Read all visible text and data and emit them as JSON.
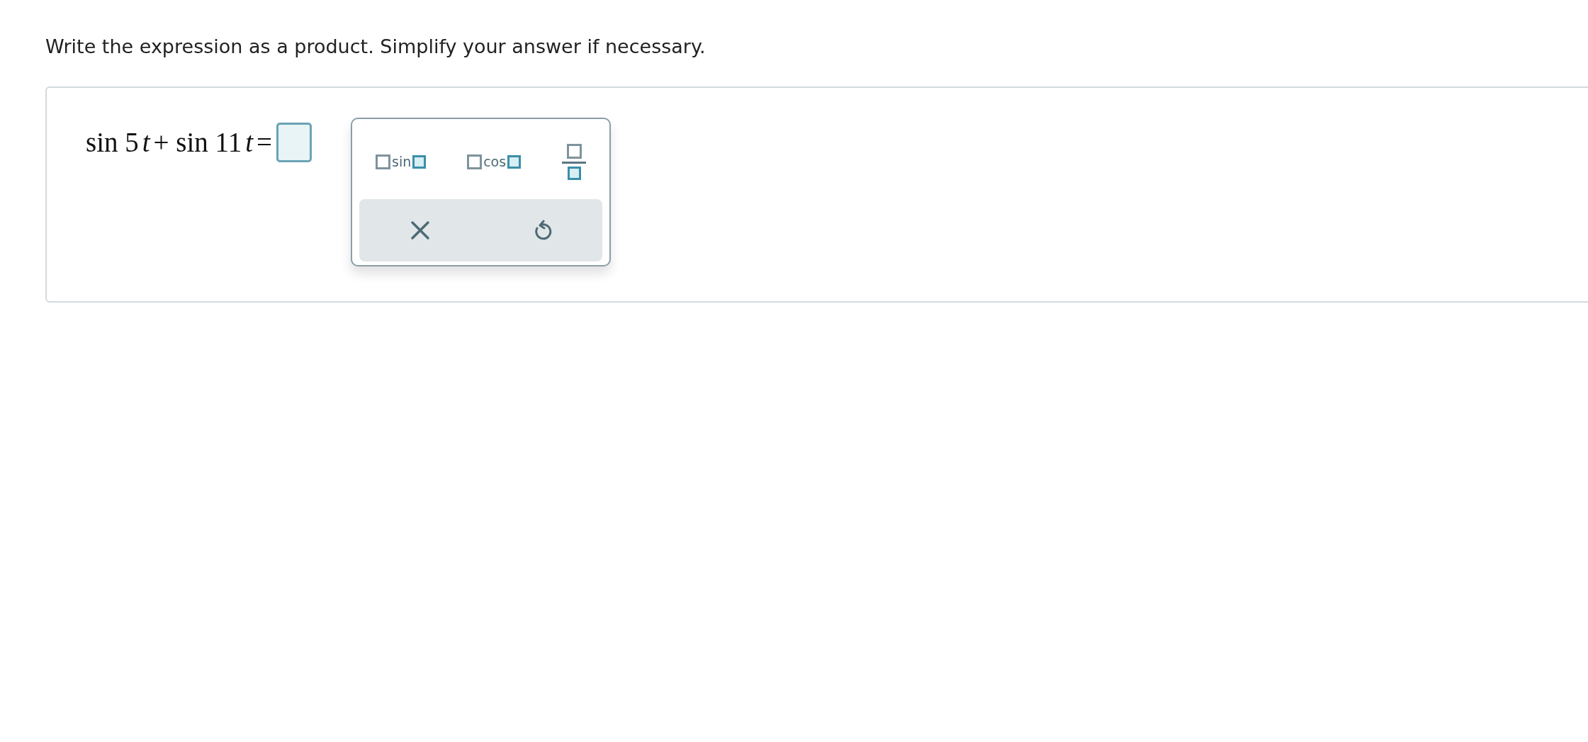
{
  "instruction": "Write the expression as a product. Simplify your answer if necessary.",
  "equation": [
    {
      "text": "sin 5",
      "italic": false
    },
    {
      "text": "t",
      "italic": true
    },
    {
      "text": "+ sin 11",
      "italic": false
    },
    {
      "text": "t",
      "italic": true
    },
    {
      "text": "=",
      "italic": false
    }
  ],
  "palette": {
    "templates": [
      {
        "kind": "function",
        "label": "sin"
      },
      {
        "kind": "function",
        "label": "cos"
      },
      {
        "kind": "fraction"
      }
    ],
    "actions": [
      {
        "kind": "clear"
      },
      {
        "kind": "undo"
      }
    ]
  }
}
